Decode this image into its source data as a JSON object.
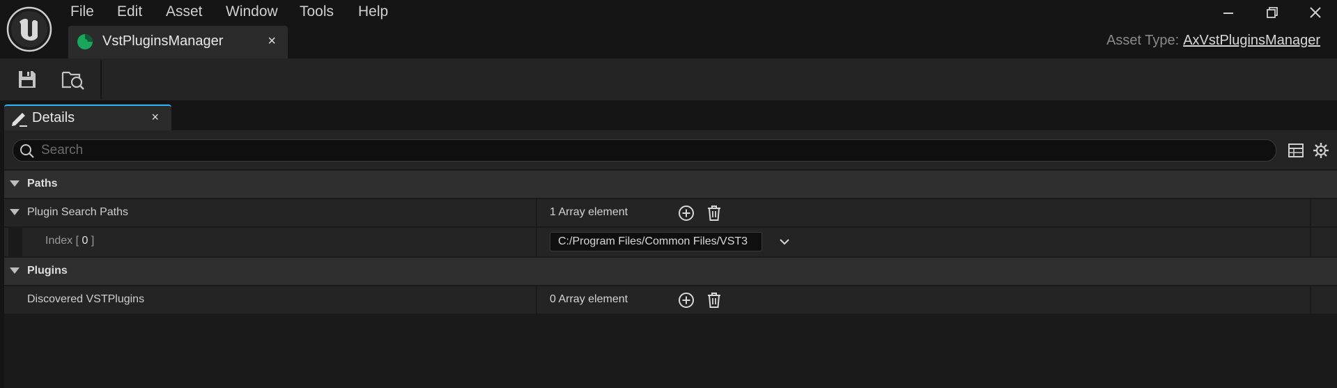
{
  "menu": [
    "File",
    "Edit",
    "Asset",
    "Window",
    "Tools",
    "Help"
  ],
  "asset_tab": {
    "title": "VstPluginsManager",
    "close": "×"
  },
  "asset_type": {
    "label": "Asset Type:",
    "value": "AxVstPluginsManager"
  },
  "toolbar": {
    "save_icon": "save-icon",
    "browse_icon": "browse-folder-icon"
  },
  "details_tab": {
    "title": "Details",
    "close": "×"
  },
  "search": {
    "placeholder": "Search",
    "value": ""
  },
  "sections": {
    "paths": {
      "label": "Paths",
      "plugin_search_paths": {
        "label": "Plugin Search Paths",
        "value": "1 Array element",
        "index_prefix": "Index [",
        "index_num": "0",
        "index_suffix": "]",
        "index_value": "C:/Program Files/Common Files/VST3"
      }
    },
    "plugins": {
      "label": "Plugins",
      "discovered": {
        "label": "Discovered VSTPlugins",
        "value": "0 Array element"
      }
    }
  },
  "colors": {
    "background": "#151515",
    "panel": "#242424",
    "category": "#2f2f2f",
    "accent": "#26bbff",
    "asset_icon": "#1aa65d"
  }
}
